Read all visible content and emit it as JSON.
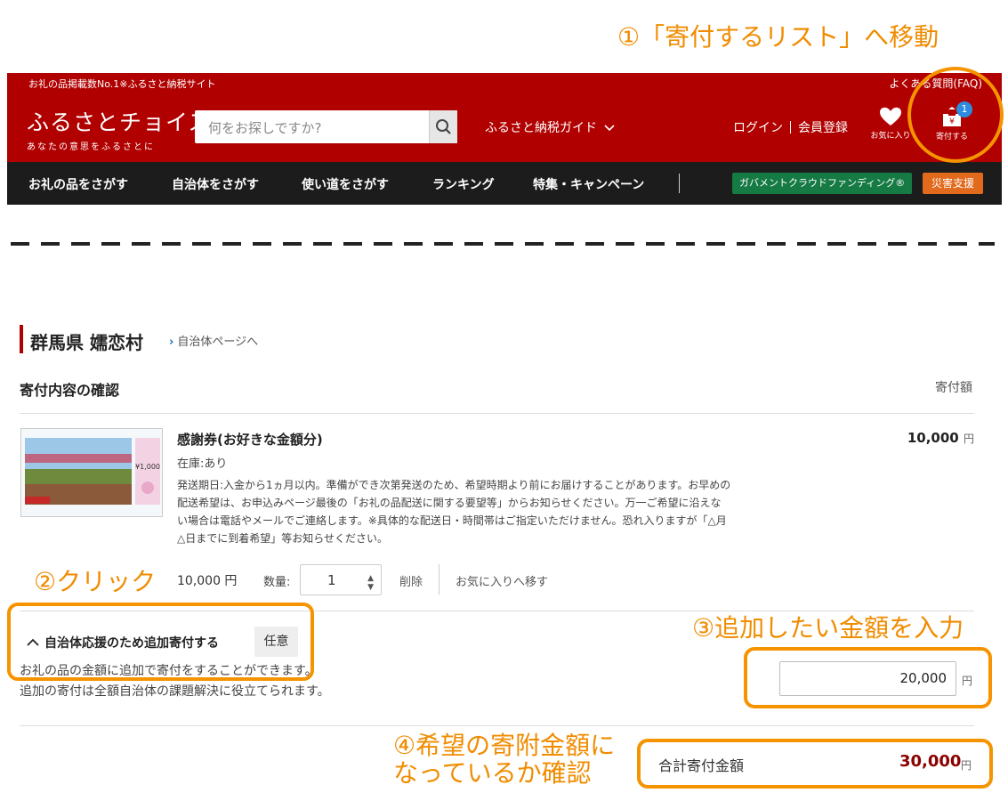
{
  "annotations": {
    "step1": "①「寄付するリスト」へ移動",
    "step2": "②クリック",
    "step3": "③追加したい金額を入力",
    "step4_line1": "④希望の寄附金額に",
    "step4_line2": "なっているか確認"
  },
  "header": {
    "tagline": "お礼の品掲載数No.1※ふるさと納税サイト",
    "faq": "よくある質問(FAQ)",
    "logo_title": "ふるさとチョイス",
    "logo_sub": "あなたの意思をふるさとに",
    "search_placeholder": "何をお探しですか?",
    "guide": "ふるさと納税ガイド",
    "login": "ログイン",
    "register": "会員登録",
    "favorites": "お気に入り",
    "donate": "寄付する",
    "cart_count": "1"
  },
  "nav": {
    "items": [
      "お礼の品をさがす",
      "自治体をさがす",
      "使い道をさがす",
      "ランキング",
      "特集・キャンペーン"
    ],
    "gov_crowdfunding": "ガバメントクラウドファンディング®",
    "disaster": "災害支援"
  },
  "municipality": {
    "name": "群馬県 嬬恋村",
    "link": "自治体ページへ"
  },
  "confirm": {
    "title": "寄付内容の確認",
    "amount_header": "寄付額"
  },
  "product": {
    "name": "感謝券(お好きな金額分)",
    "stock": "在庫:あり",
    "desc_lines": [
      "発送期日:入金から1ヵ月以内。準備ができ次第発送のため、希望時期より前にお届けすることがあります。お早めの",
      "配送希望は、お申込みページ最後の「お礼の品配送に関する要望等」からお知らせください。万一ご希望に沿えな",
      "い場合は電話やメールでご連絡します。※具体的な配送日・時間帯はご指定いただけません。恐れ入りますが「△月",
      "△日までに到着希望」等お知らせください。"
    ],
    "price": "10,000",
    "yen": "円",
    "thumb_value": "¥1,000"
  },
  "quantity": {
    "price": "10,000 円",
    "label": "数量:",
    "value": "1",
    "delete": "削除",
    "move_fav": "お気に入りへ移す"
  },
  "additional": {
    "toggle": "自治体応援のため追加寄付する",
    "optional": "任意",
    "desc1": "お礼の品の金額に追加で寄付をすることができます。",
    "desc2": "追加の寄付は全額自治体の課題解決に役立てられます。",
    "amount": "20,000",
    "unit": "円"
  },
  "total": {
    "label": "合計寄付金額",
    "value": "30,000",
    "unit": "円"
  },
  "colors": {
    "brand_red": "#b10000",
    "annotation_orange": "#f59400",
    "total_red": "#8c0000"
  }
}
